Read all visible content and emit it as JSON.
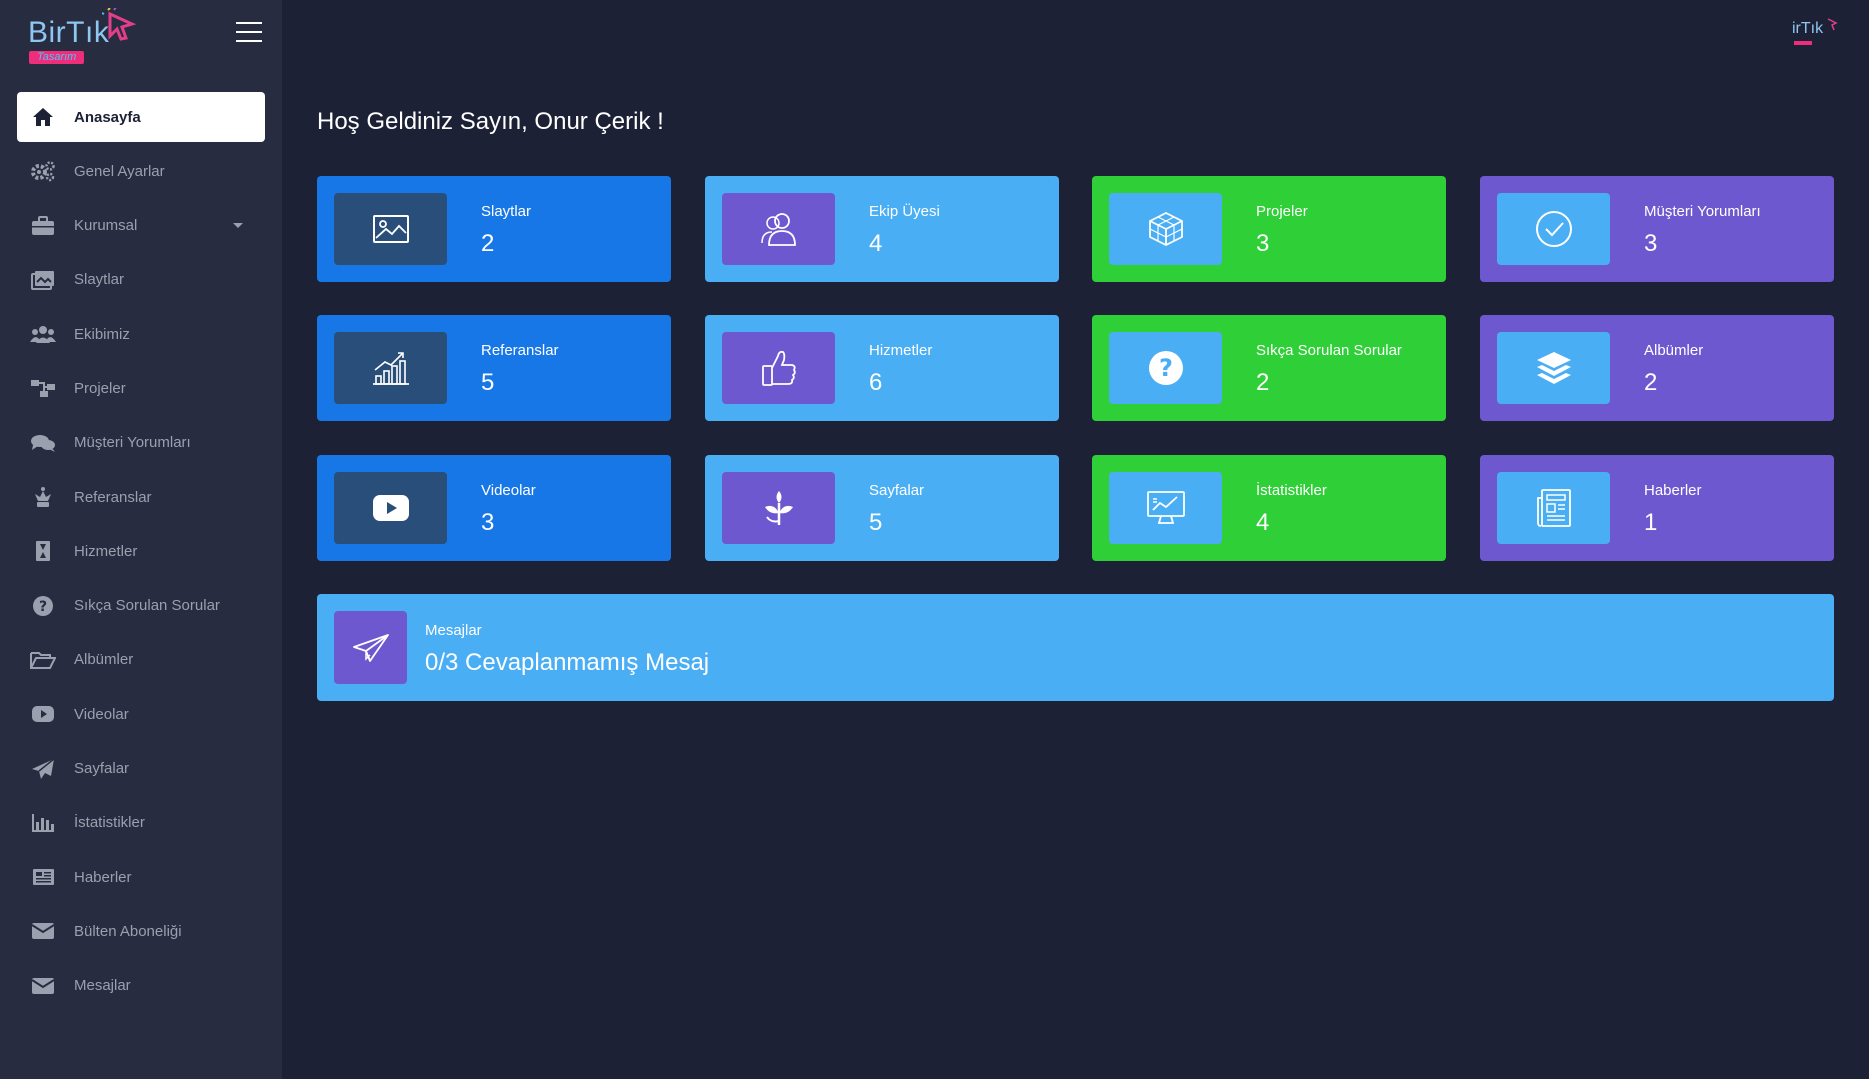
{
  "brand": {
    "name": "BirTık",
    "sub": "Tasarım",
    "small": "irTık"
  },
  "welcome": "Hoş Geldiniz Sayın, Onur Çerik !",
  "sidebar": {
    "items": [
      {
        "label": "Anasayfa",
        "icon": "home-icon"
      },
      {
        "label": "Genel Ayarlar",
        "icon": "cogs-icon"
      },
      {
        "label": "Kurumsal",
        "icon": "briefcase-icon"
      },
      {
        "label": "Slaytlar",
        "icon": "images-icon"
      },
      {
        "label": "Ekibimiz",
        "icon": "users-icon"
      },
      {
        "label": "Projeler",
        "icon": "sitemap-icon"
      },
      {
        "label": "Müşteri Yorumları",
        "icon": "comments-icon"
      },
      {
        "label": "Referanslar",
        "icon": "chess-queen-icon"
      },
      {
        "label": "Hizmetler",
        "icon": "hourglass-icon"
      },
      {
        "label": "Sıkça Sorulan Sorular",
        "icon": "question-circle-icon"
      },
      {
        "label": "Albümler",
        "icon": "folder-open-icon"
      },
      {
        "label": "Videolar",
        "icon": "youtube-icon"
      },
      {
        "label": "Sayfalar",
        "icon": "paper-plane-icon"
      },
      {
        "label": "İstatistikler",
        "icon": "bar-chart-icon"
      },
      {
        "label": "Haberler",
        "icon": "newspaper-icon"
      },
      {
        "label": "Bülten Aboneliği",
        "icon": "envelope-icon"
      },
      {
        "label": "Mesajlar",
        "icon": "envelope-icon"
      }
    ]
  },
  "cards": [
    {
      "title": "Slaytlar",
      "value": "2",
      "icon": "image-icon"
    },
    {
      "title": "Ekip Üyesi",
      "value": "4",
      "icon": "team-icon"
    },
    {
      "title": "Projeler",
      "value": "3",
      "icon": "cubes-icon"
    },
    {
      "title": "Müşteri Yorumları",
      "value": "3",
      "icon": "check-circle-icon"
    },
    {
      "title": "Referanslar",
      "value": "5",
      "icon": "growth-chart-icon"
    },
    {
      "title": "Hizmetler",
      "value": "6",
      "icon": "thumbs-up-icon"
    },
    {
      "title": "Sıkça Sorulan Sorular",
      "value": "2",
      "icon": "question-circle-icon"
    },
    {
      "title": "Albümler",
      "value": "2",
      "icon": "layers-icon"
    },
    {
      "title": "Videolar",
      "value": "3",
      "icon": "youtube-icon"
    },
    {
      "title": "Sayfalar",
      "value": "5",
      "icon": "leaf-icon"
    },
    {
      "title": "İstatistikler",
      "value": "4",
      "icon": "monitor-chart-icon"
    },
    {
      "title": "Haberler",
      "value": "1",
      "icon": "newspaper-icon"
    }
  ],
  "messages": {
    "title": "Mesajlar",
    "value": "0/3 Cevaplanmamış Mesaj",
    "icon": "paper-plane-icon"
  },
  "colors": {
    "blue": "#1877e6",
    "sky": "#4aaef5",
    "green": "#2ecf37",
    "purple": "#6e58cf",
    "bg": "#1d2135",
    "sidebar": "#272c40"
  }
}
